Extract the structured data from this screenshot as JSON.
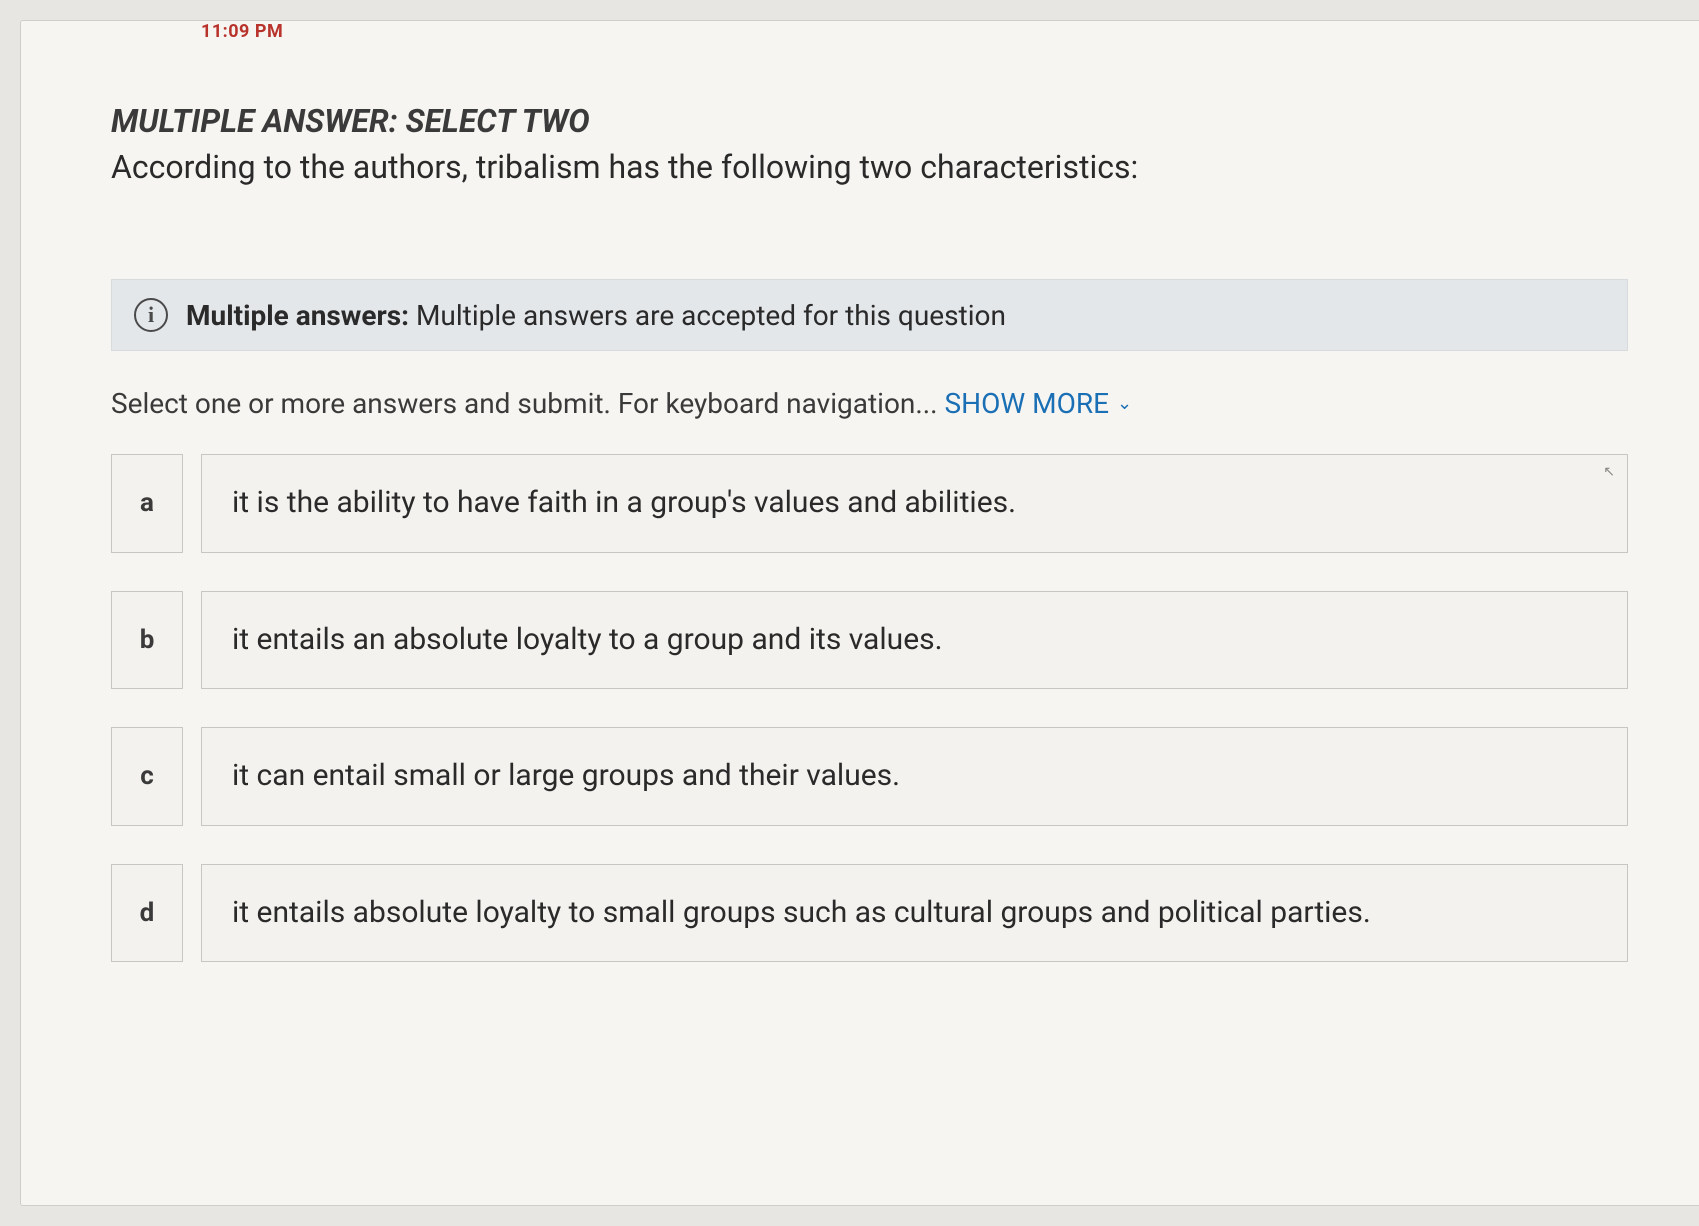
{
  "timestamp": "11:09 PM",
  "question": {
    "instruction": "MULTIPLE ANSWER: SELECT TWO",
    "prompt": "According to the authors, tribalism has the following two characteristics:"
  },
  "info_banner": {
    "label": "Multiple answers:",
    "text": "Multiple answers are accepted for this question"
  },
  "nav_hint": {
    "prefix": "Select one or more answers and submit. For keyboard navigation... ",
    "show_more": "SHOW MORE"
  },
  "options": [
    {
      "letter": "a",
      "text": "it is the ability to have faith in a group's values and abilities."
    },
    {
      "letter": "b",
      "text": "it entails an absolute loyalty to a group and its values."
    },
    {
      "letter": "c",
      "text": "it can entail small or large groups and their values."
    },
    {
      "letter": "d",
      "text": "it entails absolute loyalty to small groups such as cultural groups and political parties."
    }
  ]
}
